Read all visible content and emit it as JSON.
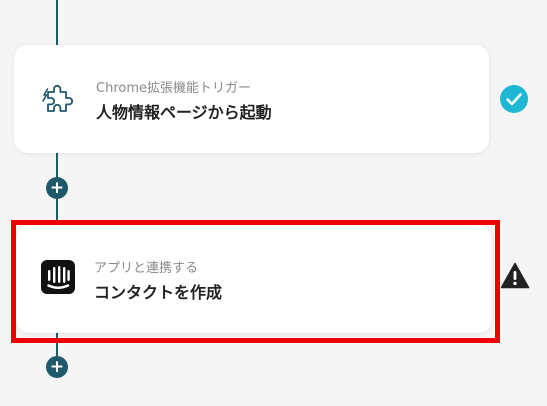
{
  "steps": [
    {
      "subtitle": "Chrome拡張機能トリガー",
      "title": "人物情報ページから起動",
      "status": "completed"
    },
    {
      "subtitle": "アプリと連携する",
      "title": "コンタクトを作成",
      "status": "warning"
    }
  ],
  "add_buttons": [
    "+",
    "+"
  ],
  "colors": {
    "connector": "#1f5a6b",
    "check": "#1fb8d4",
    "warning": "#222222",
    "highlight": "#ef0000",
    "puzzle_icon": "#1f5a6b"
  },
  "icons": {
    "step1": "puzzle-icon",
    "step2": "intercom-icon",
    "status1": "check-circle-icon",
    "status2": "warning-triangle-icon",
    "add": "plus-circle-icon"
  }
}
